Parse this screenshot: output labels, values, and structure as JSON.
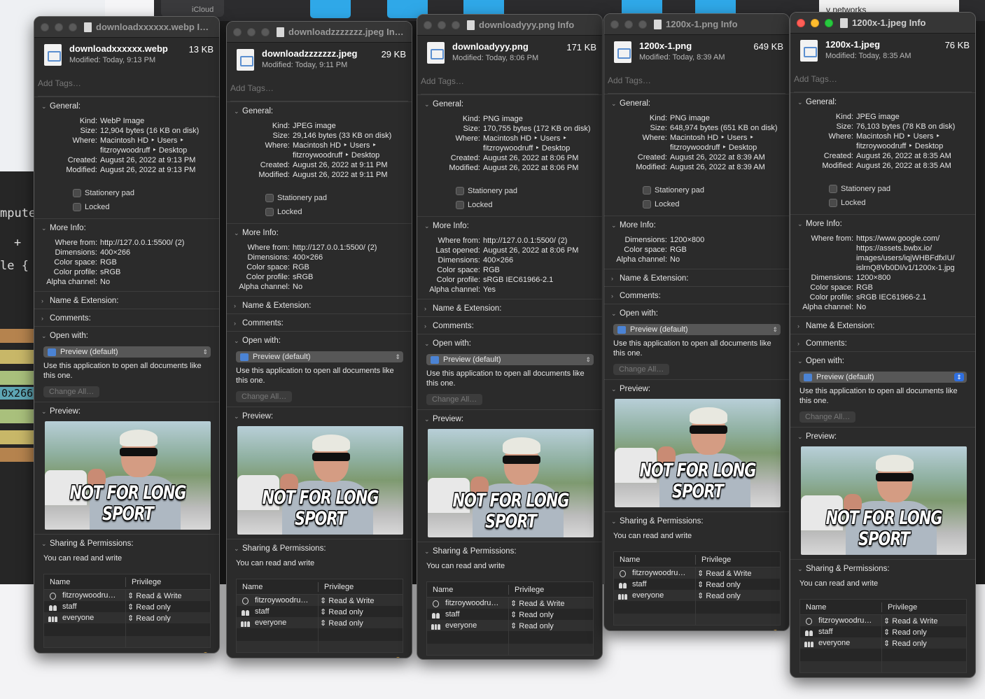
{
  "background": {
    "icloud_label": "iCloud",
    "networks_label": "v networks",
    "editor_text": [
      "mpute",
      "+",
      "le {",
      "0x266"
    ]
  },
  "common": {
    "add_tags_placeholder": "Add Tags…",
    "general_label": "General:",
    "more_info_label": "More Info:",
    "name_ext_label": "Name & Extension:",
    "comments_label": "Comments:",
    "open_with_label": "Open with:",
    "preview_label": "Preview:",
    "sharing_label": "Sharing & Permissions:",
    "stationery_label": "Stationery pad",
    "locked_label": "Locked",
    "app_default": "Preview (default)",
    "open_with_desc": "Use this application to open all documents like this one.",
    "change_all": "Change All…",
    "perm_text": "You can read and write",
    "col_name": "Name",
    "col_privilege": "Privilege",
    "caption": "NOT FOR LONG SPORT",
    "permissions": [
      {
        "name": "fitzroywoodru…",
        "privilege": "⇕ Read & Write",
        "icon": "person-icon"
      },
      {
        "name": "staff",
        "privilege": "⇕ Read only",
        "icon": "group-icon"
      },
      {
        "name": "everyone",
        "privilege": "⇕ Read only",
        "icon": "everyone-icon"
      }
    ],
    "add_btn": "+",
    "remove_btn": "−",
    "gear_btn": "⊙⌄"
  },
  "windows": [
    {
      "title": "downloadxxxxxx.webp I…",
      "name": "downloadxxxxxx.webp",
      "size": "13 KB",
      "modified": "Modified: Today, 9:13 PM",
      "general": [
        [
          "Kind:",
          "WebP Image"
        ],
        [
          "Size:",
          "12,904 bytes (16 KB on disk)"
        ],
        [
          "Where:",
          "Macintosh HD ‣ Users ‣"
        ],
        [
          "",
          "fitzroywoodruff ‣ Desktop"
        ],
        [
          "Created:",
          "August 26, 2022 at 9:13 PM"
        ],
        [
          "Modified:",
          "August 26, 2022 at 9:13 PM"
        ]
      ],
      "more_info": [
        [
          "Where from:",
          "http://127.0.0.1:5500/ (2)"
        ],
        [
          "Dimensions:",
          "400×266"
        ],
        [
          "Color space:",
          "RGB"
        ],
        [
          "Color profile:",
          "sRGB"
        ],
        [
          "Alpha channel:",
          "No"
        ]
      ]
    },
    {
      "title": "downloadzzzzzzz.jpeg In…",
      "name": "downloadzzzzzzz.jpeg",
      "size": "29 KB",
      "modified": "Modified: Today, 9:11 PM",
      "general": [
        [
          "Kind:",
          "JPEG image"
        ],
        [
          "Size:",
          "29,146 bytes (33 KB on disk)"
        ],
        [
          "Where:",
          "Macintosh HD ‣ Users ‣"
        ],
        [
          "",
          "fitzroywoodruff ‣ Desktop"
        ],
        [
          "Created:",
          "August 26, 2022 at 9:11 PM"
        ],
        [
          "Modified:",
          "August 26, 2022 at 9:11 PM"
        ]
      ],
      "more_info": [
        [
          "Where from:",
          "http://127.0.0.1:5500/ (2)"
        ],
        [
          "Dimensions:",
          "400×266"
        ],
        [
          "Color space:",
          "RGB"
        ],
        [
          "Color profile:",
          "sRGB"
        ],
        [
          "Alpha channel:",
          "No"
        ]
      ]
    },
    {
      "title": "downloadyyy.png Info",
      "name": "downloadyyy.png",
      "size": "171 KB",
      "modified": "Modified: Today, 8:06 PM",
      "general": [
        [
          "Kind:",
          "PNG image"
        ],
        [
          "Size:",
          "170,755 bytes (172 KB on disk)"
        ],
        [
          "Where:",
          "Macintosh HD ‣ Users ‣"
        ],
        [
          "",
          "fitzroywoodruff ‣ Desktop"
        ],
        [
          "Created:",
          "August 26, 2022 at 8:06 PM"
        ],
        [
          "Modified:",
          "August 26, 2022 at 8:06 PM"
        ]
      ],
      "more_info": [
        [
          "Where from:",
          "http://127.0.0.1:5500/ (2)"
        ],
        [
          "Last opened:",
          "August 26, 2022 at 8:06 PM"
        ],
        [
          "Dimensions:",
          "400×266"
        ],
        [
          "Color space:",
          "RGB"
        ],
        [
          "Color profile:",
          "sRGB IEC61966-2.1"
        ],
        [
          "Alpha channel:",
          "Yes"
        ]
      ]
    },
    {
      "title": "1200x-1.png Info",
      "name": "1200x-1.png",
      "size": "649 KB",
      "modified": "Modified: Today, 8:39 AM",
      "general": [
        [
          "Kind:",
          "PNG image"
        ],
        [
          "Size:",
          "648,974 bytes (651 KB on disk)"
        ],
        [
          "Where:",
          "Macintosh HD ‣ Users ‣"
        ],
        [
          "",
          "fitzroywoodruff ‣ Desktop"
        ],
        [
          "Created:",
          "August 26, 2022 at 8:39 AM"
        ],
        [
          "Modified:",
          "August 26, 2022 at 8:39 AM"
        ]
      ],
      "more_info": [
        [
          "Dimensions:",
          "1200×800"
        ],
        [
          "Color space:",
          "RGB"
        ],
        [
          "Alpha channel:",
          "No"
        ]
      ]
    },
    {
      "title": "1200x-1.jpeg Info",
      "name": "1200x-1.jpeg",
      "size": "76 KB",
      "modified": "Modified: Today, 8:35 AM",
      "general": [
        [
          "Kind:",
          "JPEG image"
        ],
        [
          "Size:",
          "76,103 bytes (78 KB on disk)"
        ],
        [
          "Where:",
          "Macintosh HD ‣ Users ‣"
        ],
        [
          "",
          "fitzroywoodruff ‣ Desktop"
        ],
        [
          "Created:",
          "August 26, 2022 at 8:35 AM"
        ],
        [
          "Modified:",
          "August 26, 2022 at 8:35 AM"
        ]
      ],
      "more_info": [
        [
          "Where from:",
          "https://www.google.com/"
        ],
        [
          "",
          "https://assets.bwbx.io/"
        ],
        [
          "",
          "images/users/iqjWHBFdfxIU/"
        ],
        [
          "",
          "islrnQ8Vb0DI/v1/1200x-1.jpg"
        ],
        [
          "Dimensions:",
          "1200×800"
        ],
        [
          "Color space:",
          "RGB"
        ],
        [
          "Color profile:",
          "sRGB IEC61966-2.1"
        ],
        [
          "Alpha channel:",
          "No"
        ]
      ]
    }
  ]
}
